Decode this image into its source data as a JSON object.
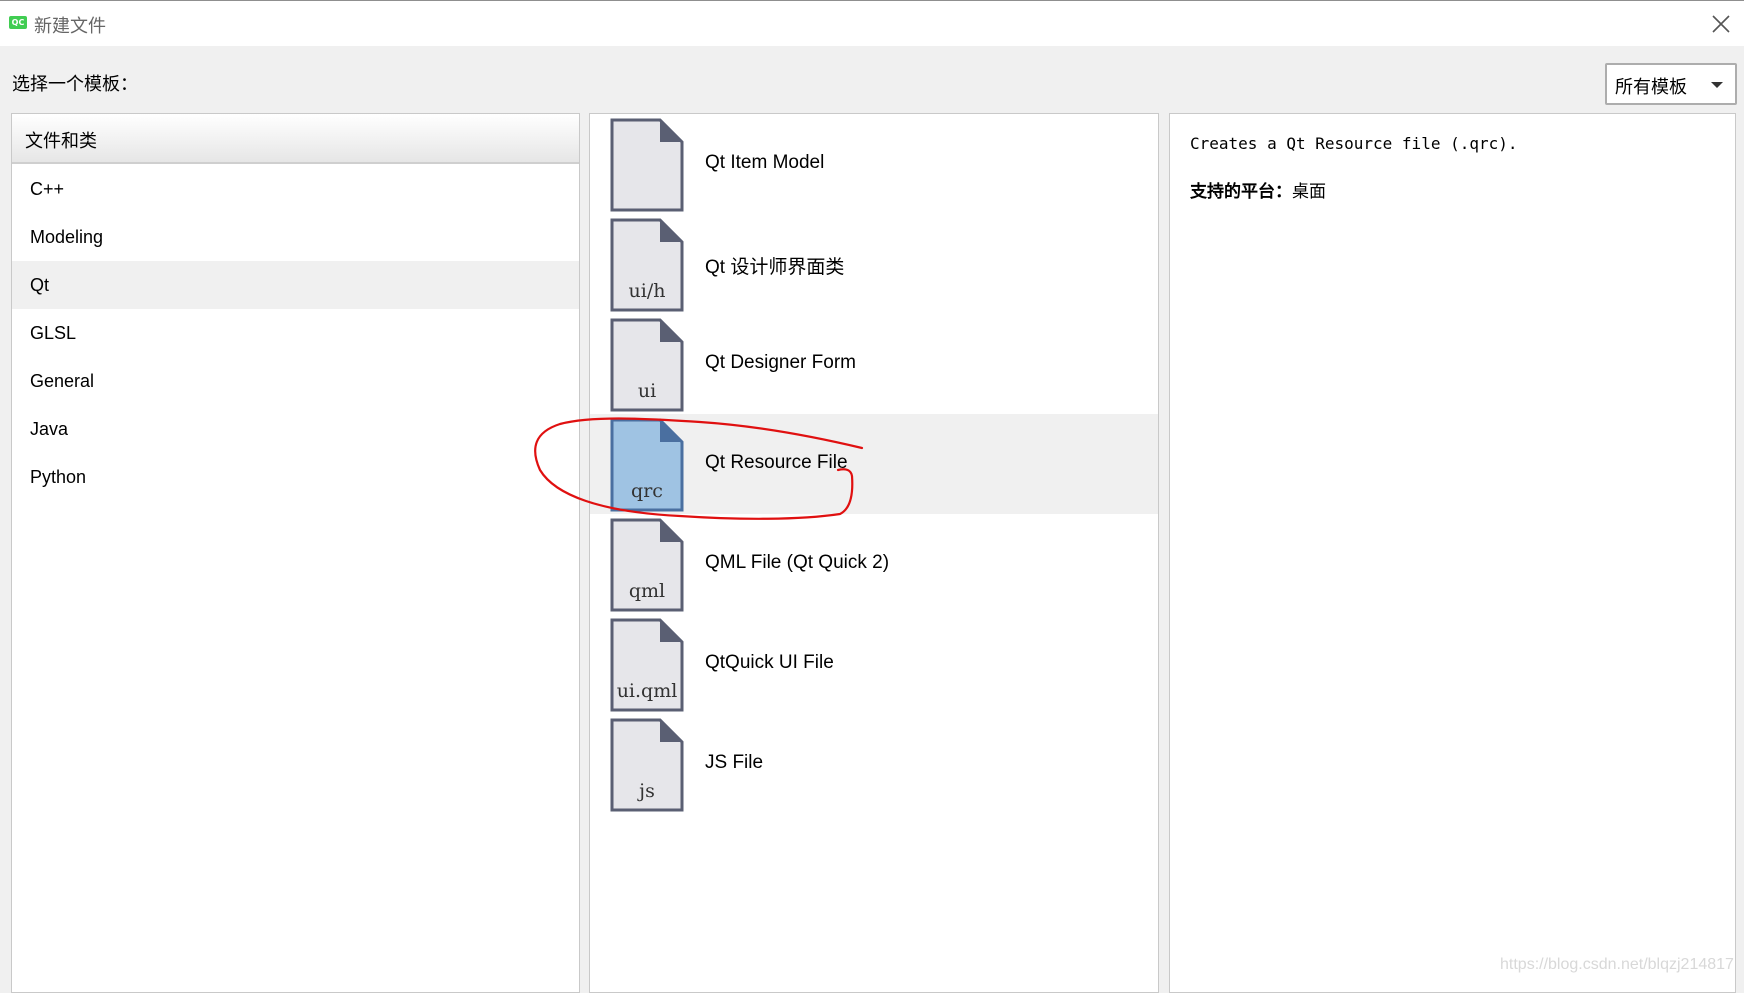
{
  "window": {
    "app_icon_text": "QC",
    "title": "新建文件"
  },
  "prompt": "选择一个模板：",
  "filter": {
    "selected": "所有模板"
  },
  "categories": {
    "header": "文件和类",
    "items": [
      {
        "label": "C++"
      },
      {
        "label": "Modeling"
      },
      {
        "label": "Qt"
      },
      {
        "label": "GLSL"
      },
      {
        "label": "General"
      },
      {
        "label": "Java"
      },
      {
        "label": "Python"
      }
    ],
    "selected_index": 2
  },
  "templates": {
    "items": [
      {
        "label": "Qt Item Model",
        "icon_tag": "",
        "icon": "blank-file-icon"
      },
      {
        "label": "Qt 设计师界面类",
        "icon_tag": "ui/h",
        "icon": "ui-header-file-icon"
      },
      {
        "label": "Qt Designer Form",
        "icon_tag": "ui",
        "icon": "ui-file-icon"
      },
      {
        "label": "Qt Resource File",
        "icon_tag": "qrc",
        "icon": "qrc-file-icon"
      },
      {
        "label": "QML File (Qt Quick 2)",
        "icon_tag": "qml",
        "icon": "qml-file-icon"
      },
      {
        "label": "QtQuick UI File",
        "icon_tag": "ui.qml",
        "icon": "ui-qml-file-icon"
      },
      {
        "label": "JS File",
        "icon_tag": "js",
        "icon": "js-file-icon"
      }
    ],
    "selected_index": 3
  },
  "details": {
    "description": "Creates a Qt Resource file (.qrc).",
    "platform_label": "支持的平台：",
    "platform_value": "桌面"
  },
  "colors": {
    "icon_fill": "#e6e6ea",
    "icon_stroke": "#5a5f73",
    "icon_selected_fill": "#9fc3e3",
    "icon_selected_stroke": "#4a6fa0",
    "annotation": "#e01010",
    "selected_row": "#f0f0f0"
  },
  "watermark": "https://blog.csdn.net/blqzj214817"
}
